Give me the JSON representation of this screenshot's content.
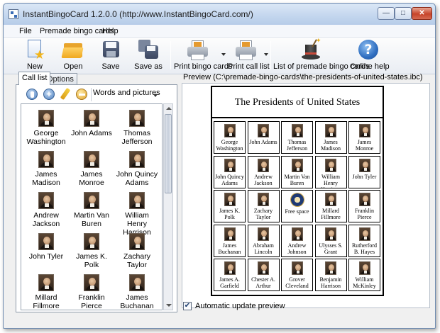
{
  "window": {
    "title": "InstantBingoCard 1.2.0.0 (http://www.InstantBingoCard.com/)"
  },
  "menu": {
    "items": [
      "File",
      "Premade bingo cards",
      "Help"
    ]
  },
  "toolbar": {
    "new": "New",
    "open": "Open",
    "save": "Save",
    "save_as": "Save as",
    "print_cards": "Print bingo cards",
    "print_call": "Print call list",
    "premade": "List of premade bingo cards",
    "help": "Online help"
  },
  "tabs": {
    "call_list": "Call list",
    "options": "Options"
  },
  "list_toolbar": {
    "mode": "Words and pictures"
  },
  "call_list": [
    "George Washington",
    "John Adams",
    "Thomas Jefferson",
    "James Madison",
    "James Monroe",
    "John Quincy Adams",
    "Andrew Jackson",
    "Martin Van Buren",
    "William Henry Harrison",
    "John Tyler",
    "James K. Polk",
    "Zachary Taylor",
    "Millard Fillmore",
    "Franklin Pierce",
    "James Buchanan"
  ],
  "preview": {
    "label": "Preview  (C:\\premade-bingo-cards\\the-presidents-of-united-states.ibc)",
    "card_title": "The Presidents of United States",
    "cells": [
      "George Washington",
      "John Adams",
      "Thomas Jefferson",
      "James Madison",
      "James Monroe",
      "John Quincy Adams",
      "Andrew Jackson",
      "Martin Van Buren",
      "William Henry Harrison",
      "John Tyler",
      "James K. Polk",
      "Zachary Taylor",
      "Free space",
      "Millard Fillmore",
      "Franklin Pierce",
      "James Buchanan",
      "Abraham Lincoln",
      "Andrew Johnson",
      "Ulysses S. Grant",
      "Rutherford B. Hayes",
      "James A. Garfield",
      "Chester A. Arthur",
      "Grover Cleveland",
      "Benjamin Harrison",
      "William McKinley"
    ],
    "free_index": 12
  },
  "options": {
    "auto_update": "Automatic update preview",
    "auto_update_checked": true
  }
}
